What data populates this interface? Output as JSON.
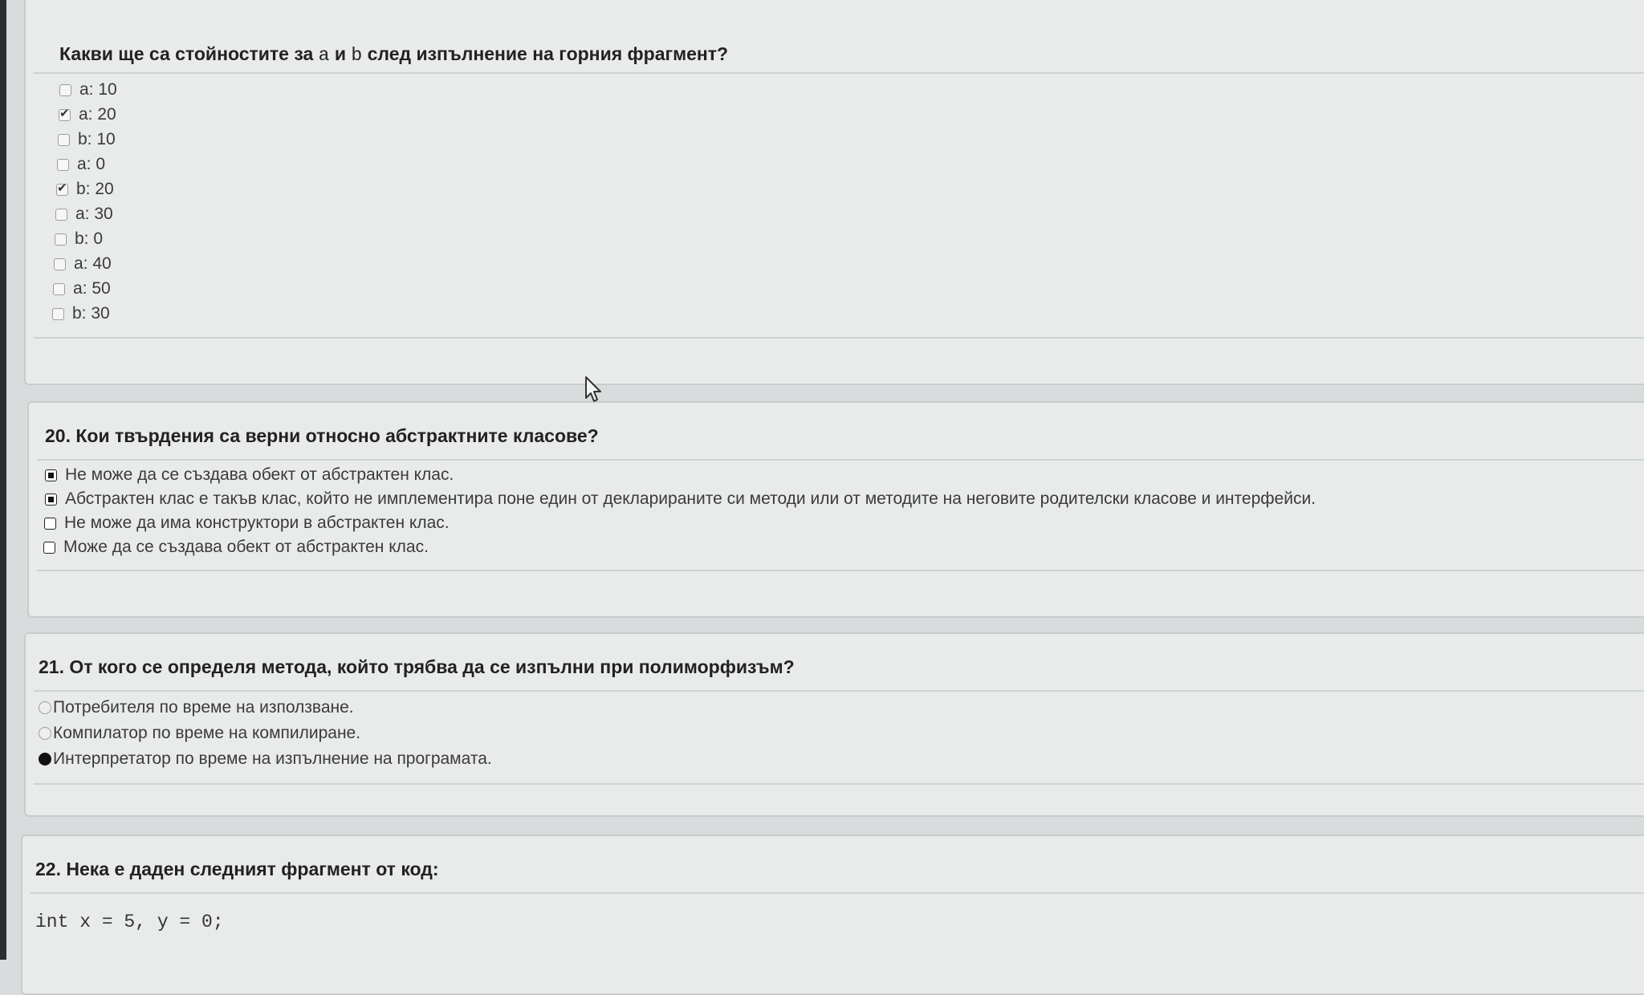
{
  "q19": {
    "title_pre": "Какви ще са стойностите за ",
    "var_a": "a",
    "title_mid": " и ",
    "var_b": "b",
    "title_post": " след изпълнение на горния фрагмент?",
    "options": [
      {
        "label": "a: 10",
        "checked": false
      },
      {
        "label": "a: 20",
        "checked": true
      },
      {
        "label": "b: 10",
        "checked": false
      },
      {
        "label": "a: 0",
        "checked": false
      },
      {
        "label": "b: 20",
        "checked": true
      },
      {
        "label": "a: 30",
        "checked": false
      },
      {
        "label": "b: 0",
        "checked": false
      },
      {
        "label": "a: 40",
        "checked": false
      },
      {
        "label": "a: 50",
        "checked": false
      },
      {
        "label": "b: 30",
        "checked": false
      }
    ]
  },
  "q20": {
    "title": "20. Кои твърдения са верни относно абстрактните класове?",
    "options": [
      {
        "label": "Не може да се създава обект от абстрактен клас.",
        "checked": true
      },
      {
        "label": "Абстрактен клас е такъв клас, който не имплементира поне един от декларираните си методи или от методите на неговите родителски класове и интерфейси.",
        "checked": true
      },
      {
        "label": "Не може да има конструктори в абстрактен клас.",
        "checked": false
      },
      {
        "label": "Може да се създава обект от абстрактен клас.",
        "checked": false
      }
    ]
  },
  "q21": {
    "title": "21. От кого се определя метода, който трябва да се изпълни при полиморфизъм?",
    "options": [
      {
        "label": "Потребителя по време на използване.",
        "selected": false
      },
      {
        "label": "Компилатор по време на компилиране.",
        "selected": false
      },
      {
        "label": "Интерпретатор по време на изпълнение на програмата.",
        "selected": true
      }
    ]
  },
  "q22": {
    "title": "22. Нека е даден следният фрагмент от код:",
    "code": "int x = 5, y = 0;"
  }
}
